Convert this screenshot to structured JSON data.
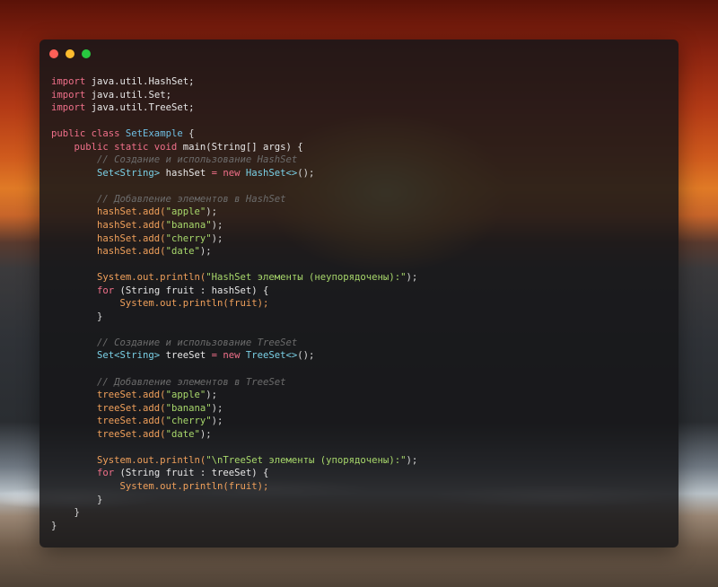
{
  "window": {
    "controls": {
      "close": "#ff5f57",
      "minimize": "#febc2e",
      "maximize": "#28c840"
    }
  },
  "code": {
    "lines": [
      [
        {
          "t": "import",
          "c": "kw"
        },
        {
          "t": " java.util.HashSet;",
          "c": "id"
        }
      ],
      [
        {
          "t": "import",
          "c": "kw"
        },
        {
          "t": " java.util.Set;",
          "c": "id"
        }
      ],
      [
        {
          "t": "import",
          "c": "kw"
        },
        {
          "t": " java.util.TreeSet;",
          "c": "id"
        }
      ],
      [],
      [
        {
          "t": "public class ",
          "c": "kw"
        },
        {
          "t": "SetExample",
          "c": "cls"
        },
        {
          "t": " {",
          "c": "pun"
        }
      ],
      [
        {
          "t": "    public static void ",
          "c": "kw"
        },
        {
          "t": "main(String[] args) {",
          "c": "id"
        }
      ],
      [
        {
          "t": "        // Создание и использование HashSet",
          "c": "com"
        }
      ],
      [
        {
          "t": "        ",
          "c": "id"
        },
        {
          "t": "Set<String>",
          "c": "typ"
        },
        {
          "t": " hashSet ",
          "c": "id"
        },
        {
          "t": "= new ",
          "c": "kw"
        },
        {
          "t": "HashSet<>",
          "c": "typ"
        },
        {
          "t": "();",
          "c": "pun"
        }
      ],
      [],
      [
        {
          "t": "        // Добавление элементов в HashSet",
          "c": "com"
        }
      ],
      [
        {
          "t": "        hashSet.add(",
          "c": "fn"
        },
        {
          "t": "\"apple\"",
          "c": "str"
        },
        {
          "t": ");",
          "c": "pun"
        }
      ],
      [
        {
          "t": "        hashSet.add(",
          "c": "fn"
        },
        {
          "t": "\"banana\"",
          "c": "str"
        },
        {
          "t": ");",
          "c": "pun"
        }
      ],
      [
        {
          "t": "        hashSet.add(",
          "c": "fn"
        },
        {
          "t": "\"cherry\"",
          "c": "str"
        },
        {
          "t": ");",
          "c": "pun"
        }
      ],
      [
        {
          "t": "        hashSet.add(",
          "c": "fn"
        },
        {
          "t": "\"date\"",
          "c": "str"
        },
        {
          "t": ");",
          "c": "pun"
        }
      ],
      [],
      [
        {
          "t": "        System.out.println(",
          "c": "fn"
        },
        {
          "t": "\"HashSet элементы (неупорядочены):\"",
          "c": "str"
        },
        {
          "t": ");",
          "c": "pun"
        }
      ],
      [
        {
          "t": "        for ",
          "c": "kw"
        },
        {
          "t": "(String fruit : hashSet) {",
          "c": "id"
        }
      ],
      [
        {
          "t": "            System.out.println(fruit);",
          "c": "fn"
        }
      ],
      [
        {
          "t": "        }",
          "c": "pun"
        }
      ],
      [],
      [
        {
          "t": "        // Создание и использование TreeSet",
          "c": "com"
        }
      ],
      [
        {
          "t": "        ",
          "c": "id"
        },
        {
          "t": "Set<String>",
          "c": "typ"
        },
        {
          "t": " treeSet ",
          "c": "id"
        },
        {
          "t": "= new ",
          "c": "kw"
        },
        {
          "t": "TreeSet<>",
          "c": "typ"
        },
        {
          "t": "();",
          "c": "pun"
        }
      ],
      [],
      [
        {
          "t": "        // Добавление элементов в TreeSet",
          "c": "com"
        }
      ],
      [
        {
          "t": "        treeSet.add(",
          "c": "fn"
        },
        {
          "t": "\"apple\"",
          "c": "str"
        },
        {
          "t": ");",
          "c": "pun"
        }
      ],
      [
        {
          "t": "        treeSet.add(",
          "c": "fn"
        },
        {
          "t": "\"banana\"",
          "c": "str"
        },
        {
          "t": ");",
          "c": "pun"
        }
      ],
      [
        {
          "t": "        treeSet.add(",
          "c": "fn"
        },
        {
          "t": "\"cherry\"",
          "c": "str"
        },
        {
          "t": ");",
          "c": "pun"
        }
      ],
      [
        {
          "t": "        treeSet.add(",
          "c": "fn"
        },
        {
          "t": "\"date\"",
          "c": "str"
        },
        {
          "t": ");",
          "c": "pun"
        }
      ],
      [],
      [
        {
          "t": "        System.out.println(",
          "c": "fn"
        },
        {
          "t": "\"\\nTreeSet элементы (упорядочены):\"",
          "c": "str"
        },
        {
          "t": ");",
          "c": "pun"
        }
      ],
      [
        {
          "t": "        for ",
          "c": "kw"
        },
        {
          "t": "(String fruit : treeSet) {",
          "c": "id"
        }
      ],
      [
        {
          "t": "            System.out.println(fruit);",
          "c": "fn"
        }
      ],
      [
        {
          "t": "        }",
          "c": "pun"
        }
      ],
      [
        {
          "t": "    }",
          "c": "pun"
        }
      ],
      [
        {
          "t": "}",
          "c": "pun"
        }
      ]
    ]
  }
}
